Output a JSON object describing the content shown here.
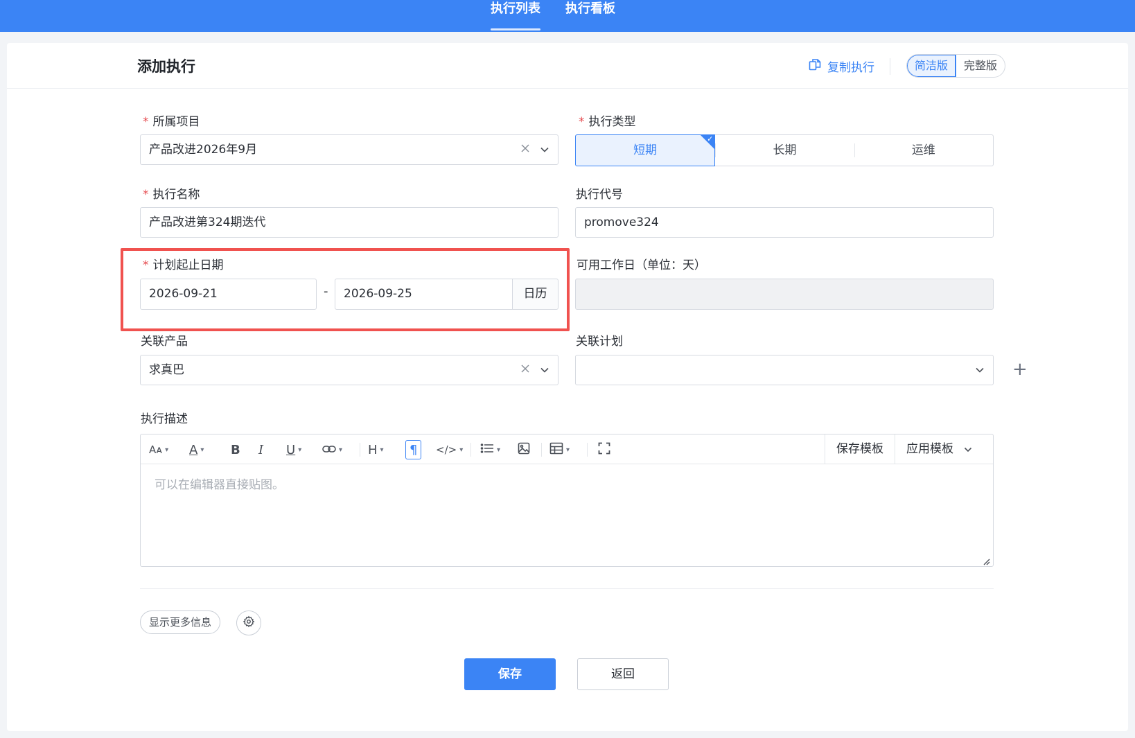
{
  "nav": {
    "tabs": [
      {
        "label": "执行列表",
        "active": true
      },
      {
        "label": "执行看板",
        "active": false
      }
    ]
  },
  "header": {
    "title": "添加执行",
    "copy_label": "复制执行",
    "mode_options": [
      "简洁版",
      "完整版"
    ],
    "mode_selected": "简洁版"
  },
  "form": {
    "project": {
      "label": "所属项目",
      "required": true,
      "value": "产品改进2026年9月"
    },
    "exec_type": {
      "label": "执行类型",
      "required": true,
      "options": [
        "短期",
        "长期",
        "运维"
      ],
      "selected": "短期"
    },
    "exec_name": {
      "label": "执行名称",
      "required": true,
      "value": "产品改进第324期迭代"
    },
    "exec_code": {
      "label": "执行代号",
      "required": false,
      "value": "promove324"
    },
    "plan_dates": {
      "label": "计划起止日期",
      "required": true,
      "start": "2026-09-21",
      "separator": "-",
      "end": "2026-09-25",
      "calendar_label": "日历"
    },
    "workdays": {
      "label": "可用工作日（单位：天）",
      "value": ""
    },
    "product": {
      "label": "关联产品",
      "value": "求真巴"
    },
    "plan": {
      "label": "关联计划",
      "value": ""
    },
    "description": {
      "label": "执行描述",
      "placeholder": "可以在编辑器直接贴图。",
      "save_template_label": "保存模板",
      "apply_template_label": "应用模板"
    }
  },
  "footer": {
    "more_info_label": "显示更多信息",
    "save_label": "保存",
    "back_label": "返回"
  },
  "colors": {
    "accent": "#3b84f5",
    "highlight": "#f0524f",
    "required": "#e5484d"
  }
}
